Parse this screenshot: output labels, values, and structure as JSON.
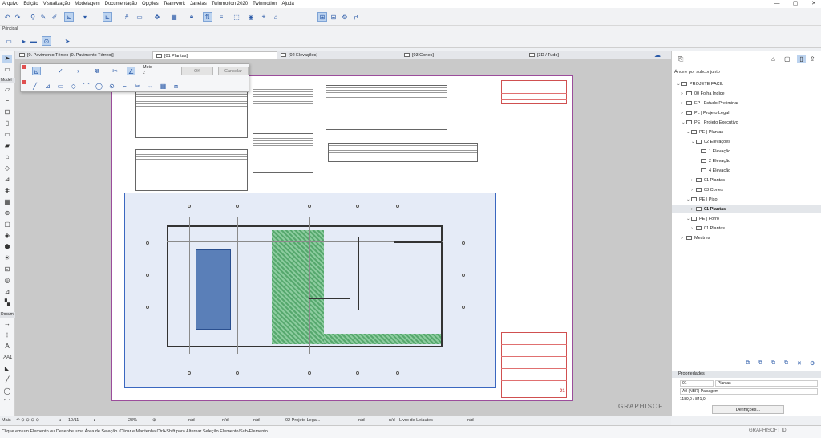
{
  "menu": [
    "Arquivo",
    "Edição",
    "Visualização",
    "Modelagem",
    "Documentação",
    "Opções",
    "Teamwork",
    "Janelas",
    "Twinmotion 2020",
    "Twinmotion",
    "Ajuda"
  ],
  "window_controls": {
    "minimize": "—",
    "maximize": "▢",
    "close": "✕"
  },
  "toolbar": {
    "label": "Principal"
  },
  "tabs": [
    {
      "label": "[0. Pavimento Térreo (0. Pavimento Térreo)]",
      "icon": "floorplan-icon"
    },
    {
      "label": "[01 Plantas]",
      "icon": "layout-icon",
      "active": true
    },
    {
      "label": "[02 Elevações]",
      "icon": "elevation-icon"
    },
    {
      "label": "[03 Cortes]",
      "icon": "section-icon"
    },
    {
      "label": "[3D / Tudo]",
      "icon": "3d-icon"
    }
  ],
  "toolbox": {
    "design_label": "Model",
    "document_label": "Docum"
  },
  "palette": {
    "select_label": "Meio",
    "select_value": "2",
    "ok_label": "OK",
    "cancel_label": "Cancelar"
  },
  "navigator": {
    "header": "Árvore por subconjunto",
    "items": [
      {
        "label": "PROJETE FACIL",
        "level": 0,
        "expanded": true
      },
      {
        "label": "00 Folha Índice",
        "level": 1
      },
      {
        "label": "EP | Estudo Preliminar",
        "level": 1
      },
      {
        "label": "PL | Projeto Legal",
        "level": 1
      },
      {
        "label": "PE | Projeto Executivo",
        "level": 1,
        "expanded": true
      },
      {
        "label": "PE | Plantas",
        "level": 2,
        "expanded": true
      },
      {
        "label": "02 Elevações",
        "level": 3,
        "expanded": true
      },
      {
        "label": "1 Elevação",
        "level": 4
      },
      {
        "label": "2 Elevação",
        "level": 4
      },
      {
        "label": "4 Elevação",
        "level": 4
      },
      {
        "label": "01 Plantas",
        "level": 3
      },
      {
        "label": "03 Cortes",
        "level": 3
      },
      {
        "label": "PE | Piso",
        "level": 2,
        "expanded": true
      },
      {
        "label": "01 Plantas",
        "level": 3,
        "selected": true
      },
      {
        "label": "PE | Forro",
        "level": 2,
        "expanded": true
      },
      {
        "label": "01 Plantas",
        "level": 3
      },
      {
        "label": "Mestres",
        "level": 1
      }
    ],
    "properties": {
      "header": "Propriedades",
      "id": "01",
      "name": "Plantas",
      "paper": "A0 (NBR) Paisagem",
      "size": "1189,0 / 841,0",
      "settings_button": "Definições..."
    }
  },
  "canvas": {
    "watermark": "GRAPHISOFT",
    "sheet_number": "01"
  },
  "viewbar": {
    "menu_label": "Mais",
    "page": "10/11",
    "zoom": "23%",
    "nd1": "n/d",
    "nd2": "n/d",
    "nd3": "n/d",
    "layer": "02 Projeto Lega...",
    "nd4": "n/d",
    "nd5": "n/d",
    "book": "Livro de Leiautes",
    "nd6": "n/d"
  },
  "statusbar": {
    "message": "Clique em um Elemento ou Desenhe uma Área de Seleção. Clicar e Mantenha Ctrl+Shift para Alternar Seleção Elemento/Sub-Elemento.",
    "brand": "GRAPHISOFT ID"
  },
  "colors": {
    "accent": "#2a5aa8",
    "selection": "#3a67c0",
    "green_hatch": "#3d9c55",
    "pool": "#5a7fb8"
  }
}
